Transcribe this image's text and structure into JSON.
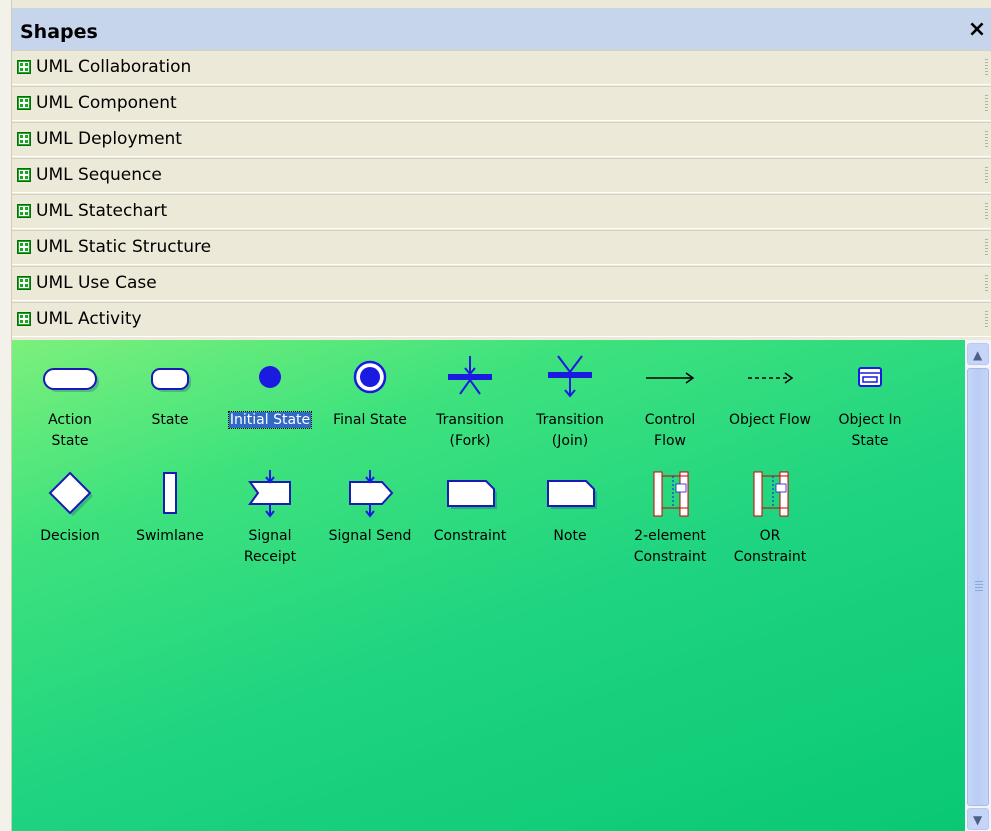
{
  "panel": {
    "title": "Shapes",
    "close_label": "×"
  },
  "categories": [
    "UML Collaboration",
    "UML Component",
    "UML Deployment",
    "UML Sequence",
    "UML Statechart",
    "UML Static Structure",
    "UML Use Case",
    "UML Activity"
  ],
  "shapes": [
    {
      "line1": "Action",
      "line2": "State",
      "icon": "action-state-icon"
    },
    {
      "line1": "State",
      "line2": "",
      "icon": "state-icon"
    },
    {
      "line1": "Initial State",
      "line2": "",
      "icon": "initial-state-icon",
      "selected": true
    },
    {
      "line1": "Final State",
      "line2": "",
      "icon": "final-state-icon"
    },
    {
      "line1": "Transition",
      "line2": "(Fork)",
      "icon": "fork-icon"
    },
    {
      "line1": "Transition",
      "line2": "(Join)",
      "icon": "join-icon"
    },
    {
      "line1": "Control",
      "line2": "Flow",
      "icon": "control-flow-icon"
    },
    {
      "line1": "Object Flow",
      "line2": "",
      "icon": "object-flow-icon"
    },
    {
      "line1": "Object In",
      "line2": "State",
      "icon": "object-in-state-icon"
    },
    {
      "line1": "Decision",
      "line2": "",
      "icon": "decision-icon"
    },
    {
      "line1": "Swimlane",
      "line2": "",
      "icon": "swimlane-icon"
    },
    {
      "line1": "Signal",
      "line2": "Receipt",
      "icon": "signal-receipt-icon"
    },
    {
      "line1": "Signal Send",
      "line2": "",
      "icon": "signal-send-icon"
    },
    {
      "line1": "Constraint",
      "line2": "",
      "icon": "constraint-icon"
    },
    {
      "line1": "Note",
      "line2": "",
      "icon": "note-icon"
    },
    {
      "line1": "2-element",
      "line2": "Constraint",
      "icon": "two-element-constraint-icon"
    },
    {
      "line1": "OR",
      "line2": "Constraint",
      "icon": "or-constraint-icon"
    }
  ],
  "scrollbar": {
    "up_arrow": "▲",
    "down_arrow": "▼"
  }
}
